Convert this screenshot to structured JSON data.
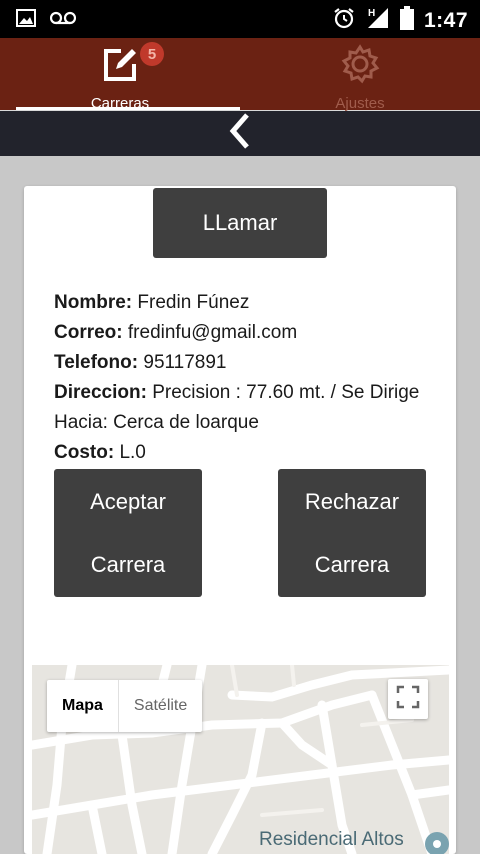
{
  "status_bar": {
    "time": "1:47",
    "icons": [
      "image-icon",
      "voicemail-icon",
      "alarm-icon",
      "signal-h-icon",
      "battery-icon"
    ]
  },
  "tabs": [
    {
      "label": "Carreras",
      "icon": "edit-icon",
      "badge": "5",
      "active": true
    },
    {
      "label": "Ajustes",
      "icon": "gear-icon",
      "active": false
    }
  ],
  "nav": {
    "back_icon": "chevron-left-icon"
  },
  "card": {
    "call_label": "LLamar",
    "nombre": {
      "label": "Nombre:",
      "value": "Fredin Fúnez"
    },
    "correo": {
      "label": "Correo:",
      "value": "fredinfu@gmail.com"
    },
    "telefono": {
      "label": "Telefono:",
      "value": "95117891"
    },
    "direccion": {
      "label": "Direccion:",
      "value": "Precision : 77.60 mt. / Se Dirige Hacia: Cerca de loarque"
    },
    "costo": {
      "label": "Costo:",
      "value": "L.0"
    },
    "accept": {
      "line1": "Aceptar",
      "line2": "Carrera"
    },
    "reject": {
      "line1": "Rechazar",
      "line2": "Carrera"
    }
  },
  "map": {
    "type_map": "Mapa",
    "type_satellite": "Satélite",
    "place_label": "Residencial Altos"
  },
  "colors": {
    "tabbar": "#6b2213",
    "backbar": "#22232c",
    "button": "#3f3f3f",
    "badge": "#c0392b"
  }
}
